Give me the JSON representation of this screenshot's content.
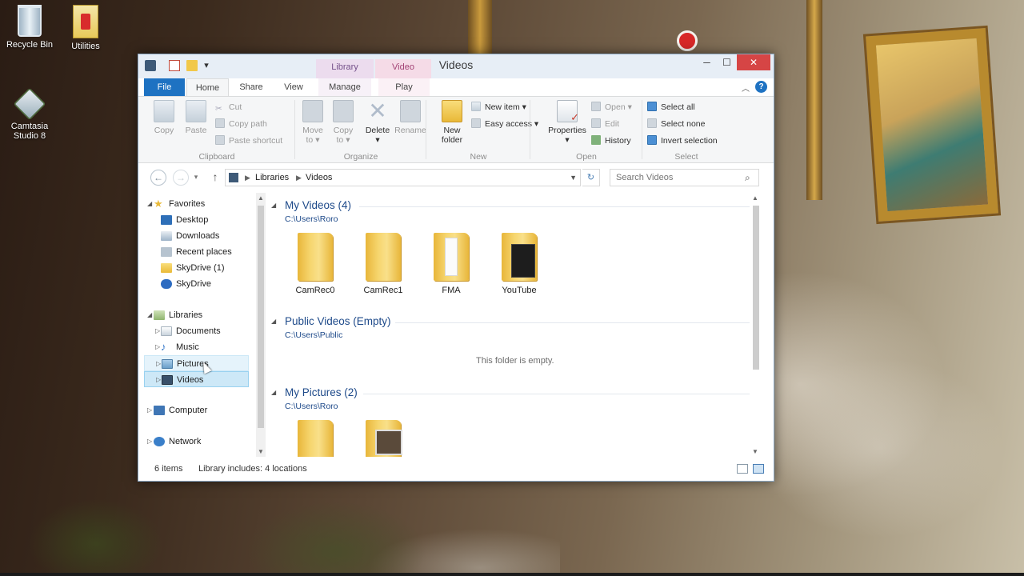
{
  "desktop": {
    "icons": [
      {
        "label": "Recycle Bin",
        "icon": "recycle-bin-icon"
      },
      {
        "label": "Utilities",
        "icon": "folder-icon"
      },
      {
        "label": "Camtasia Studio 8",
        "icon": "camtasia-icon"
      }
    ]
  },
  "window": {
    "title": "Videos",
    "contextual_tabs": {
      "library_tools": "Library Tools",
      "video_tools": "Video Tools"
    },
    "controls": {
      "minimize": "─",
      "maximize": "☐",
      "close": "✕"
    }
  },
  "ribbon": {
    "tabs": [
      "File",
      "Home",
      "Share",
      "View",
      "Manage",
      "Play"
    ],
    "active_tab": "Home",
    "groups": {
      "clipboard": {
        "label": "Clipboard",
        "copy": "Copy",
        "paste": "Paste",
        "cut": "Cut",
        "copy_path": "Copy path",
        "paste_shortcut": "Paste shortcut"
      },
      "organize": {
        "label": "Organize",
        "move_to": [
          "Move",
          "to ▾"
        ],
        "copy_to": [
          "Copy",
          "to ▾"
        ],
        "delete": [
          "Delete",
          "▾"
        ],
        "rename": "Rename"
      },
      "new": {
        "label": "New",
        "new_folder": [
          "New",
          "folder"
        ],
        "new_item": "New item ▾",
        "easy_access": "Easy access ▾"
      },
      "open": {
        "label": "Open",
        "properties": [
          "Properties",
          "▾"
        ],
        "open": "Open ▾",
        "edit": "Edit",
        "history": "History"
      },
      "select": {
        "label": "Select",
        "select_all": "Select all",
        "select_none": "Select none",
        "invert_selection": "Invert selection"
      }
    }
  },
  "address_bar": {
    "breadcrumb": [
      "Libraries",
      "Videos"
    ],
    "search_placeholder": "Search Videos"
  },
  "nav_pane": {
    "favorites": {
      "label": "Favorites",
      "items": [
        "Desktop",
        "Downloads",
        "Recent places",
        "SkyDrive (1)",
        "SkyDrive"
      ]
    },
    "libraries": {
      "label": "Libraries",
      "items": [
        "Documents",
        "Music",
        "Pictures",
        "Videos"
      ],
      "hovered": "Pictures",
      "selected": "Videos"
    },
    "computer": "Computer",
    "network": "Network"
  },
  "content": {
    "groups": [
      {
        "title": "My Videos (4)",
        "path": "C:\\Users\\Roro",
        "items": [
          "CamRec0",
          "CamRec1",
          "FMA",
          "YouTube"
        ]
      },
      {
        "title": "Public Videos (Empty)",
        "path": "C:\\Users\\Public",
        "empty_message": "This folder is empty."
      },
      {
        "title": "My Pictures (2)",
        "path": "C:\\Users\\Roro",
        "items": [
          "",
          ""
        ]
      }
    ]
  },
  "status_bar": {
    "item_count": "6 items",
    "library_info": "Library includes: 4 locations"
  }
}
